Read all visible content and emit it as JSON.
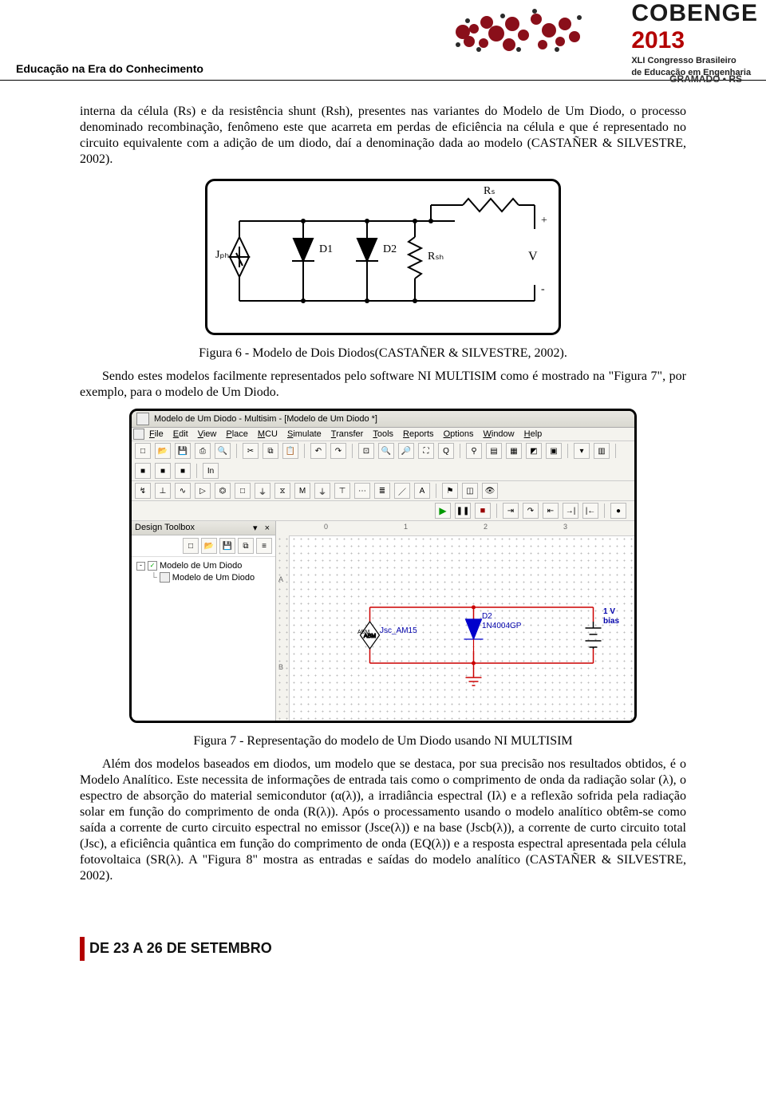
{
  "header": {
    "tagline": "Educação na Era do Conhecimento",
    "logoTitle": "COBENGE",
    "logoYear": "2013",
    "logoSub1": "XLI Congresso Brasileiro",
    "logoSub2": "de Educação em Engenharia",
    "gramado": "GRAMADO • RS"
  },
  "body": {
    "p1": "interna da célula (Rs) e da resistência shunt (Rsh), presentes nas variantes do Modelo de Um Diodo, o processo denominado recombinação, fenômeno este que acarreta em perdas de eficiência na célula e que é representado no circuito equivalente com a adição de um diodo, daí a denominação dada ao modelo (CASTAÑER & SILVESTRE, 2002).",
    "fig6cap": "Figura 6 - Modelo de Dois Diodos(CASTAÑER & SILVESTRE, 2002).",
    "p2": "Sendo estes modelos facilmente representados pelo software NI MULTISIM como é mostrado na \"Figura 7\", por exemplo, para o modelo de Um Diodo.",
    "fig7cap": "Figura 7 - Representação do modelo de Um Diodo usando NI MULTISIM",
    "p3": "Além dos modelos baseados em diodos, um modelo que se destaca, por sua precisão nos resultados obtidos, é o Modelo Analítico. Este necessita de informações de entrada tais como o comprimento de onda da radiação solar (λ), o espectro de absorção do material semicondutor (α(λ)), a irradiância espectral (Iλ) e a reflexão sofrida pela radiação solar em função do comprimento de onda (R(λ)). Após o processamento usando o modelo analítico obtêm-se como saída a corrente de curto circuito espectral no emissor (Jsce(λ)) e na base (Jscb(λ)), a corrente de curto circuito total (Jsc), a eficiência quântica em função do comprimento de onda (EQ(λ)) e a resposta espectral apresentada pela célula fotovoltaica (SR(λ). A \"Figura 8\" mostra as entradas e saídas do modelo analítico (CASTAÑER & SILVESTRE, 2002)."
  },
  "circuit": {
    "Jph": "Jₚₕ",
    "D1": "D1",
    "D2": "D2",
    "Rsh": "Rₛₕ",
    "Rs": "Rₛ",
    "V": "V",
    "plus": "+",
    "minus": "-"
  },
  "multisim": {
    "title": "Modelo de Um Diodo - Multisim - [Modelo de Um Diodo *]",
    "menus": [
      "File",
      "Edit",
      "View",
      "Place",
      "MCU",
      "Simulate",
      "Transfer",
      "Tools",
      "Reports",
      "Options",
      "Window",
      "Help"
    ],
    "toolbar1_icons": [
      "new",
      "open",
      "save",
      "print",
      "preview",
      "|",
      "cut",
      "copy",
      "paste",
      "|",
      "undo",
      "redo",
      "|",
      "zoom-box",
      "zoom-in",
      "zoom-out",
      "fit",
      "zoom-100",
      "|",
      "probe",
      "list",
      "grid",
      "mixed",
      "chip",
      "|",
      "dropdown",
      "calendar",
      "|",
      "color1",
      "color2",
      "color3",
      "|",
      "in"
    ],
    "toolbar2_icons": [
      "r",
      "c",
      "l",
      "d",
      "q",
      "u",
      "g",
      "t",
      "m",
      "gnd",
      "vcc",
      "misc",
      "bus",
      "wire",
      "text",
      "|",
      "flag",
      "scope",
      "watch"
    ],
    "sim_icons": [
      "play",
      "pause",
      "stop",
      "|",
      "step-in",
      "step-over",
      "step-out",
      "step-to",
      "step-back",
      "|",
      "breakpoint"
    ],
    "sideTitle": "Design Toolbox",
    "tree_root": "Modelo de Um Diodo",
    "tree_child": "Modelo de Um Diodo",
    "source_label": "Jsc_AM15",
    "diode_ref": "D2",
    "diode_part": "1N4004GP",
    "vsrc_line1": "1 V",
    "vsrc_line2": "bias",
    "ruler_h": [
      "0",
      "1",
      "2",
      "3"
    ],
    "ruler_v": [
      "A",
      "B"
    ],
    "side_close": "×",
    "side_pin": "▾",
    "abm_label": "ABM"
  },
  "footer": {
    "dates": "DE 23 A 26 DE SETEMBRO"
  }
}
